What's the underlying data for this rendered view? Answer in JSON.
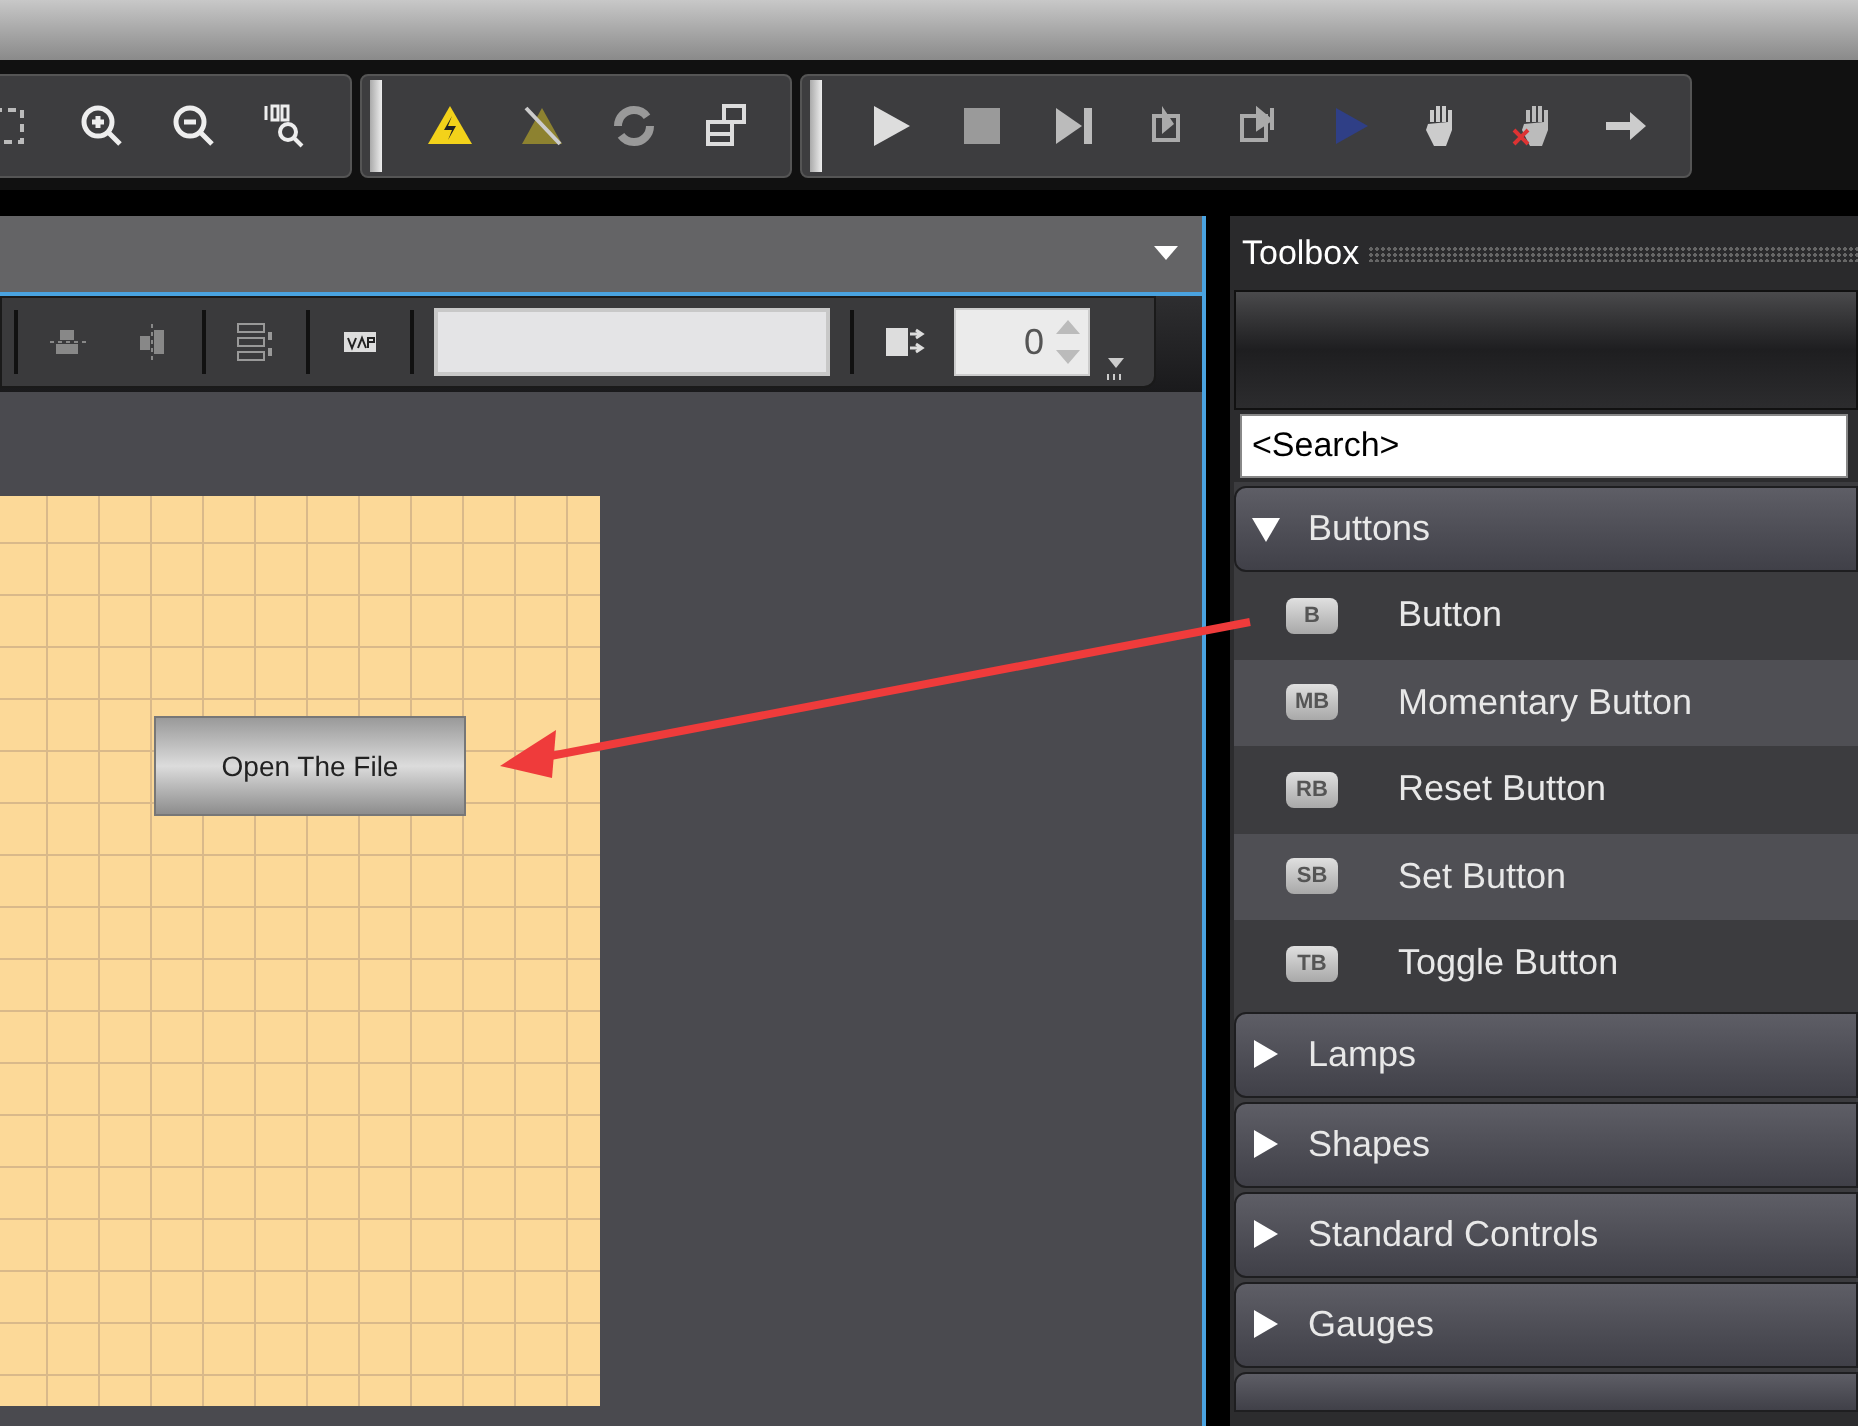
{
  "toolbar_groups": [
    {
      "tools": [
        {
          "kind": "frame"
        },
        {
          "kind": "zoom-in"
        },
        {
          "kind": "zoom-out"
        },
        {
          "kind": "zoom-100"
        }
      ]
    },
    {
      "tools": [
        {
          "kind": "warning"
        },
        {
          "kind": "warning-off"
        },
        {
          "kind": "refresh"
        },
        {
          "kind": "screens"
        }
      ]
    },
    {
      "tools": [
        {
          "kind": "play"
        },
        {
          "kind": "stop"
        },
        {
          "kind": "step"
        },
        {
          "kind": "step-in"
        },
        {
          "kind": "step-out"
        },
        {
          "kind": "run-blue"
        },
        {
          "kind": "hand"
        },
        {
          "kind": "hand-x"
        },
        {
          "kind": "arrow"
        }
      ]
    }
  ],
  "property_bar": {
    "spin_field": {
      "value": "0"
    }
  },
  "canvas": {
    "button_label": "Open The File"
  },
  "toolbox": {
    "title": "Toolbox",
    "search": {
      "value": "<Search>"
    },
    "categories": [
      {
        "label": "Buttons",
        "expanded": true,
        "items": [
          {
            "badge": "B",
            "label": "Button"
          },
          {
            "badge": "MB",
            "label": "Momentary Button"
          },
          {
            "badge": "RB",
            "label": "Reset Button"
          },
          {
            "badge": "SB",
            "label": "Set Button"
          },
          {
            "badge": "TB",
            "label": "Toggle Button"
          }
        ]
      },
      {
        "label": "Lamps",
        "expanded": false
      },
      {
        "label": "Shapes",
        "expanded": false
      },
      {
        "label": "Standard Controls",
        "expanded": false
      },
      {
        "label": "Gauges",
        "expanded": false
      }
    ]
  }
}
